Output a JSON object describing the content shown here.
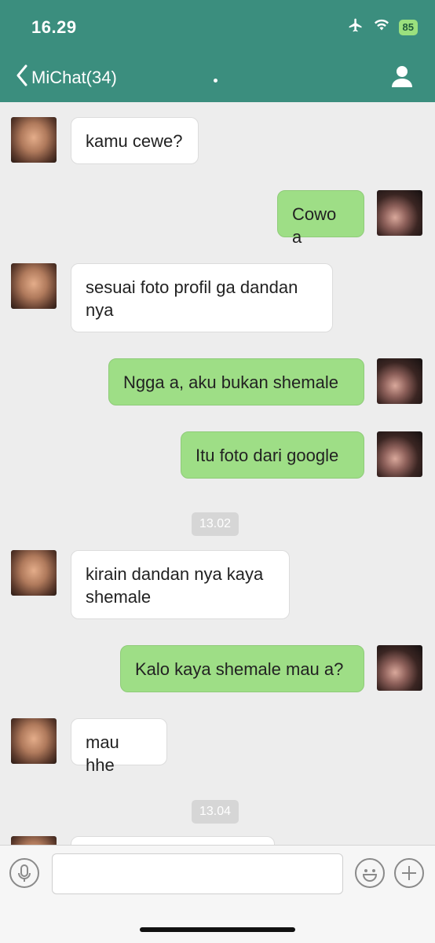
{
  "status_bar": {
    "time": "16.29",
    "battery": "85"
  },
  "header": {
    "back_label": "MiChat(34)"
  },
  "messages": [
    {
      "side": "in",
      "text": "kamu cewe?"
    },
    {
      "side": "out",
      "text": "Cowo a"
    },
    {
      "side": "in",
      "text": "sesuai foto profil ga dandan nya"
    },
    {
      "side": "out",
      "text": "Ngga a, aku bukan shemale"
    },
    {
      "side": "out",
      "text": "Itu foto dari google"
    },
    {
      "side": "in",
      "text": "kirain dandan nya kaya shemale"
    },
    {
      "side": "out",
      "text": "Kalo kaya shemale mau a?"
    },
    {
      "side": "in",
      "text": "mau hhe"
    }
  ],
  "timestamps": [
    "13.02",
    "13.04"
  ],
  "icons": {
    "back": "chevron-left-icon",
    "profile": "person-icon",
    "airplane": "airplane-icon",
    "wifi": "wifi-icon",
    "battery": "battery-icon",
    "voice": "microphone-icon",
    "emoji": "smiley-icon",
    "add": "plus-icon"
  },
  "colors": {
    "header": "#3b8e7e",
    "outgoing_bubble": "#9ede86",
    "incoming_bubble": "#ffffff",
    "chat_bg": "#ededed"
  }
}
